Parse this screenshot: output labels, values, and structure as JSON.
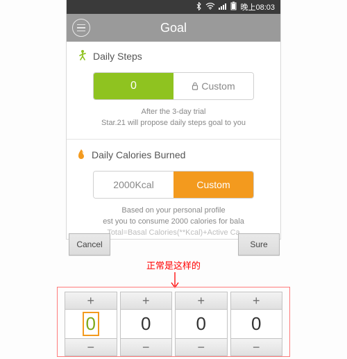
{
  "status": {
    "time": "晚上08:03",
    "bt": "✱",
    "wifi": "⋮",
    "sig": "📶"
  },
  "header": {
    "title": "Goal"
  },
  "steps": {
    "title": "Daily Steps",
    "value": "0",
    "custom": "Custom",
    "hint1": "After the 3-day trial",
    "hint2": "Star.21 will propose daily steps goal to you"
  },
  "cal": {
    "title": "Daily Calories Burned",
    "value": "2000Kcal",
    "custom": "Custom",
    "hint1": "Based on your personal profile",
    "hint2": "est you to consume 2000 calories for bala",
    "hint3": "Total=Basal Calories(**Kcal)+Active Ca"
  },
  "overlay": {
    "cancel": "Cancel",
    "sure": "Sure"
  },
  "annotation": {
    "text": "正常是这样的"
  },
  "picker": {
    "cols": [
      {
        "val": "0",
        "active": true
      },
      {
        "val": "0",
        "active": false
      },
      {
        "val": "0",
        "active": false
      },
      {
        "val": "0",
        "active": false
      }
    ],
    "plus": "+",
    "minus": "−"
  }
}
